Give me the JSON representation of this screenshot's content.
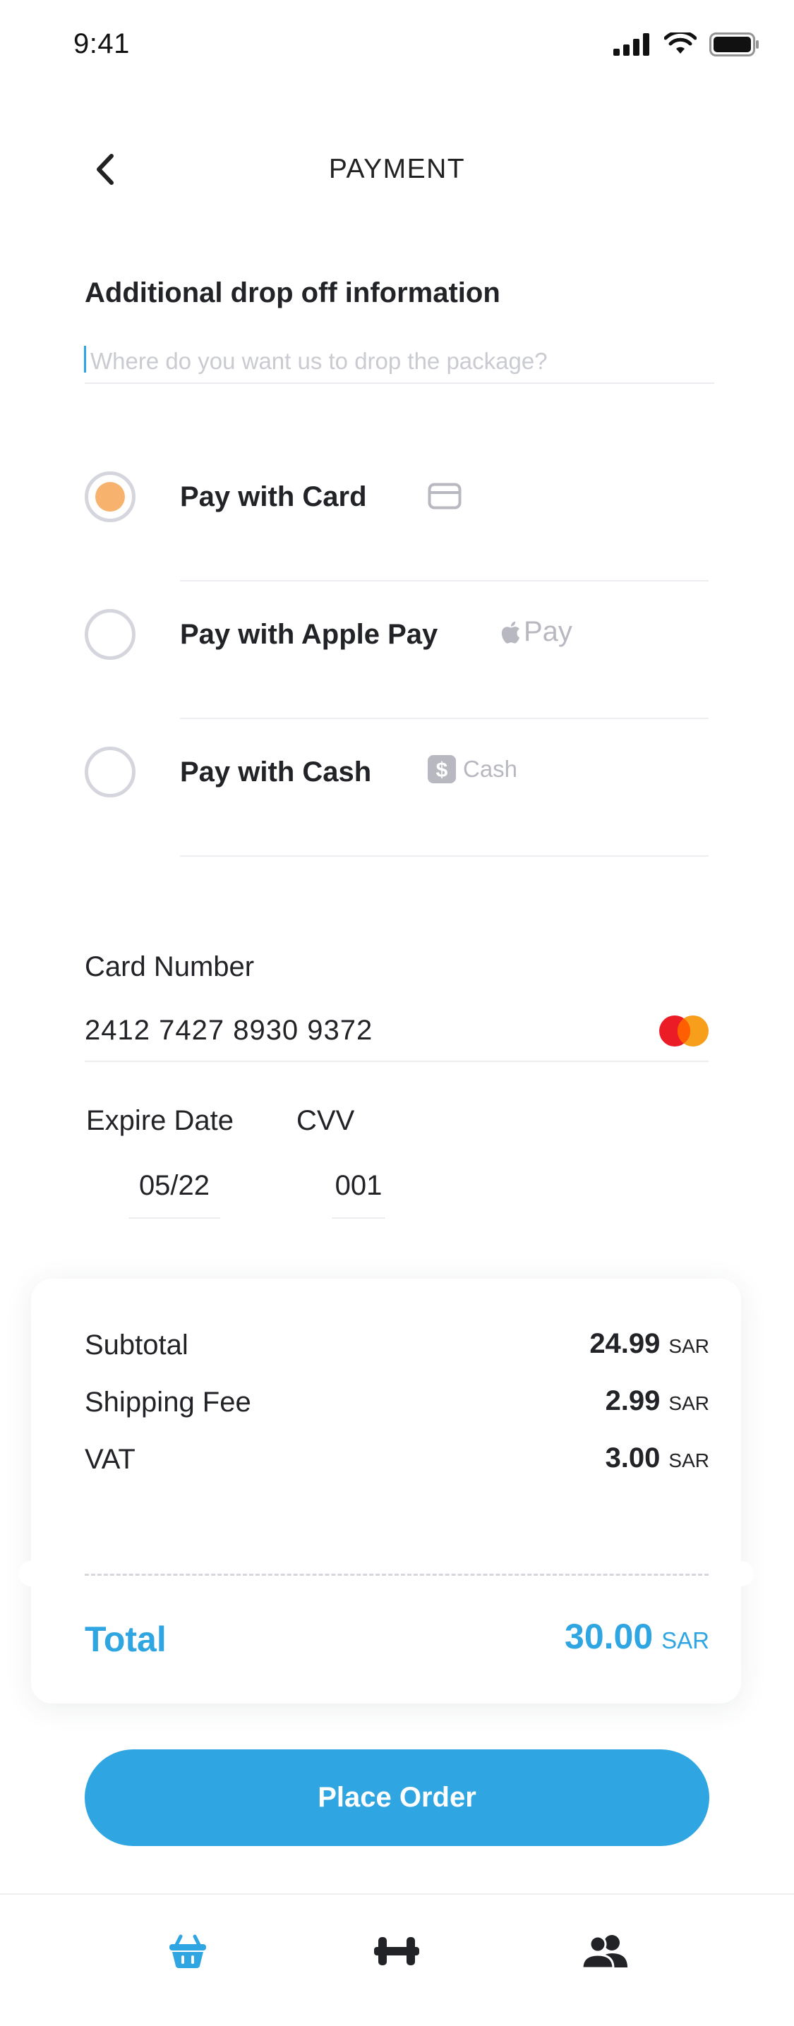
{
  "status_bar": {
    "time": "9:41"
  },
  "header": {
    "title": "PAYMENT"
  },
  "dropoff": {
    "title": "Additional drop off information",
    "placeholder": "Where do you want us to drop the package?",
    "value": ""
  },
  "payment_options": [
    {
      "label": "Pay with Card",
      "selected": true,
      "icon": "card-icon"
    },
    {
      "label": "Pay with Apple Pay",
      "selected": false,
      "icon": "apple-pay-icon",
      "icon_text": "Pay"
    },
    {
      "label": "Pay with Cash",
      "selected": false,
      "icon": "cash-icon",
      "icon_text": "Cash"
    }
  ],
  "card": {
    "number_label": "Card Number",
    "number": "2412 7427 8930 9372",
    "expire_label": "Expire Date",
    "expire": "05/22",
    "cvv_label": "CVV",
    "cvv": "001"
  },
  "summary": {
    "rows": [
      {
        "label": "Subtotal",
        "value": "24.99",
        "currency": "SAR"
      },
      {
        "label": "Shipping Fee",
        "value": "2.99",
        "currency": "SAR"
      },
      {
        "label": "VAT",
        "value": "3.00",
        "currency": "SAR"
      }
    ],
    "total_label": "Total",
    "total_value": "30.00",
    "total_currency": "SAR"
  },
  "place_order_label": "Place Order",
  "nav": {
    "items": [
      "basket-icon",
      "dumbbell-icon",
      "users-icon"
    ],
    "active": "basket-icon"
  },
  "colors": {
    "accent": "#2fa6e2",
    "radio_selected": "#f7b36e",
    "text": "#222327",
    "muted": "#b8b9c0"
  }
}
